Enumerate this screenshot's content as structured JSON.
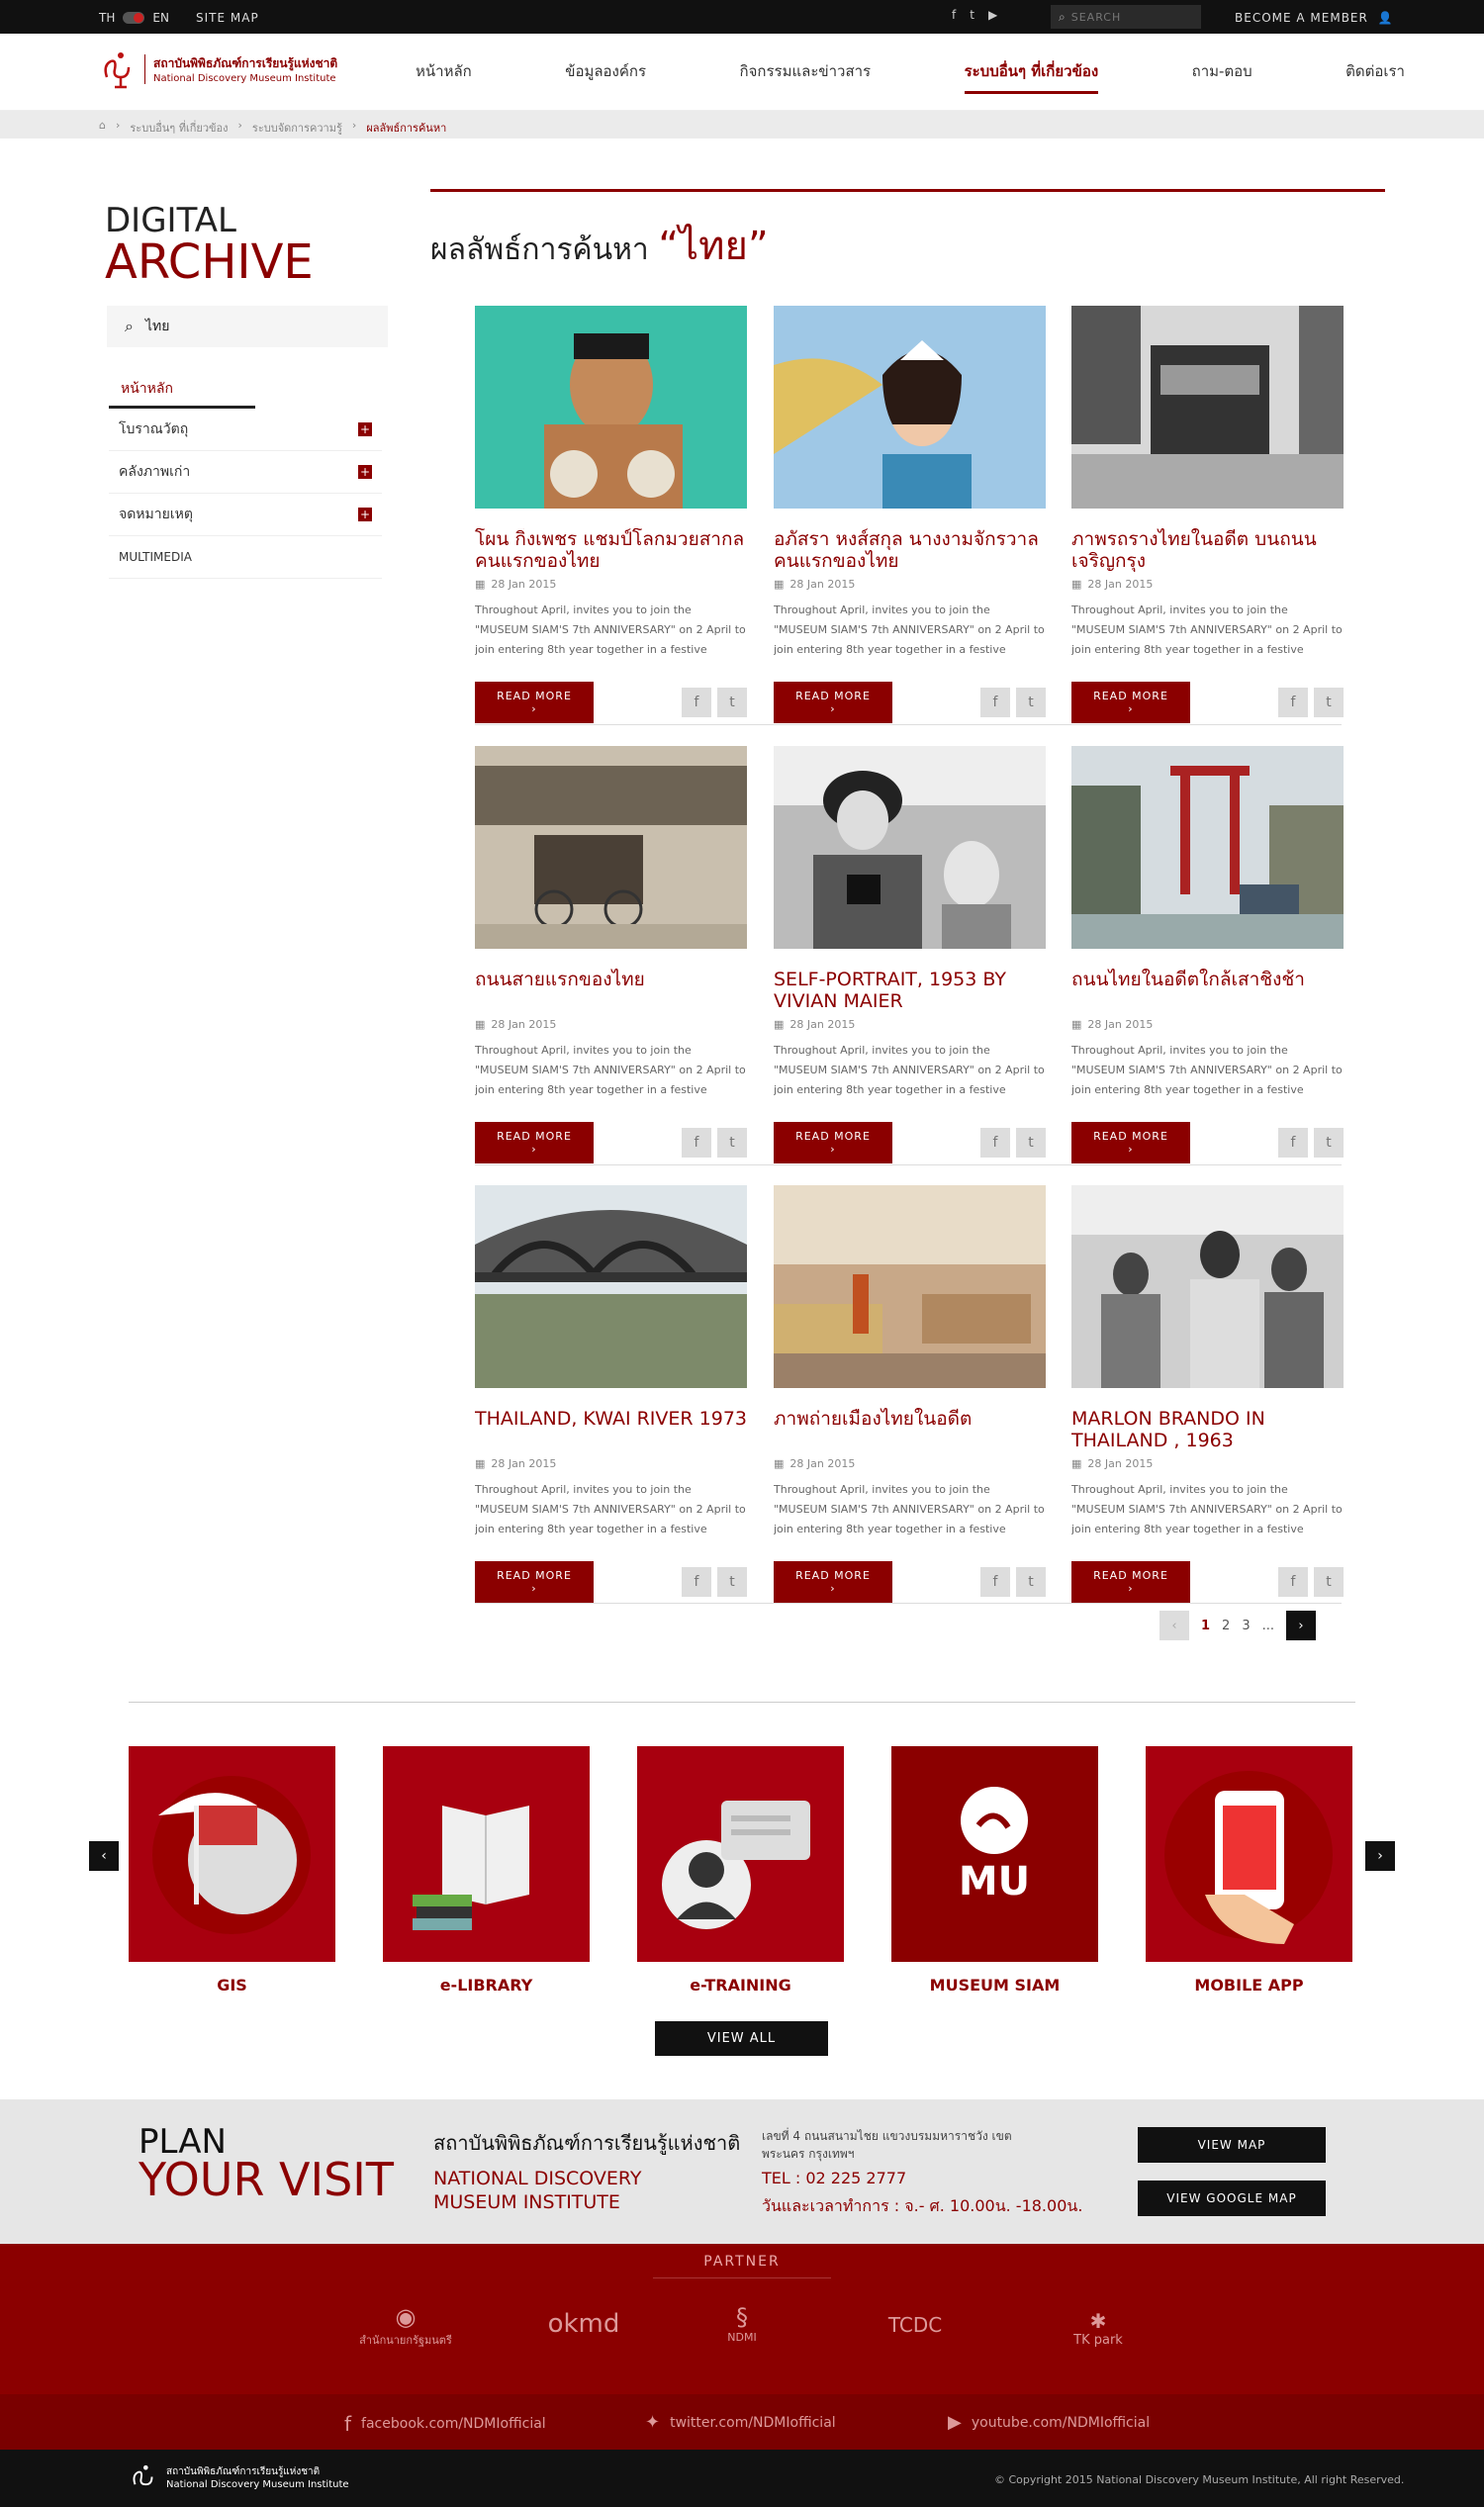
{
  "topbar": {
    "lang_th": "TH",
    "lang_en": "EN",
    "sitemap": "SITE MAP",
    "search_placeholder": "SEARCH",
    "member": "BECOME A MEMBER"
  },
  "logo": {
    "th": "สถาบันพิพิธภัณฑ์การเรียนรู้แห่งชาติ",
    "en": "National Discovery Museum Institute"
  },
  "nav": [
    "หน้าหลัก",
    "ข้อมูลองค์กร",
    "กิจกรรมและข่าวสาร",
    "ระบบอื่นๆ ที่เกี่ยวข้อง",
    "ถาม-ตอบ",
    "ติดต่อเรา"
  ],
  "breadcrumb": {
    "c1": "ระบบอื่นๆ ที่เกี่ยวข้อง",
    "c2": "ระบบจัดการความรู้",
    "c3": "ผลลัพธ์การค้นหา"
  },
  "sidebar": {
    "title1": "DIGITAL",
    "title2": "ARCHIVE",
    "search_value": "ไทย",
    "home": "หน้าหลัก",
    "items": [
      "โบราณวัตถุ",
      "คลังภาพเก่า",
      "จดหมายเหตุ",
      "MULTIMEDIA"
    ]
  },
  "results": {
    "label": "ผลลัพธ์การค้นหา",
    "query": "“ไทย”"
  },
  "cards": [
    {
      "title": "โผน กิ่งเพชร แชมป์โลกมวยสากลคนแรกของไทย",
      "date": "28 Jan 2015"
    },
    {
      "title": "อภัสรา หงส์สกุล นางงามจักรวาลคนแรกของไทย",
      "date": "28 Jan 2015"
    },
    {
      "title": "ภาพรถรางไทยในอดีต บนถนนเจริญกรุง",
      "date": "28 Jan 2015"
    },
    {
      "title": "ถนนสายแรกของไทย",
      "date": "28 Jan 2015"
    },
    {
      "title": "SELF-PORTRAIT, 1953 BY VIVIAN MAIER",
      "date": "28 Jan 2015"
    },
    {
      "title": "ถนนไทยในอดีตใกล้เสาชิงช้า",
      "date": "28 Jan 2015"
    },
    {
      "title": "THAILAND, KWAI RIVER 1973",
      "date": "28 Jan 2015"
    },
    {
      "title": "ภาพถ่ายเมืองไทยในอดีต",
      "date": "28 Jan 2015"
    },
    {
      "title": "MARLON BRANDO IN THAILAND , 1963",
      "date": "28 Jan 2015"
    }
  ],
  "card_desc": "Throughout April, invites you to join the \"MUSEUM SIAM'S 7th ANNIVERSARY\" on 2 April to join entering 8th year together in a festive atmosphere that ..",
  "read_more": "READ MORE",
  "pager": {
    "p1": "1",
    "p2": "2",
    "p3": "3",
    "dots": "..."
  },
  "services": [
    "GIS",
    "e-LIBRARY",
    "e-TRAINING",
    "MUSEUM SIAM",
    "MOBILE APP"
  ],
  "view_all": "VIEW ALL",
  "plan": {
    "l1": "PLAN",
    "l2": "YOUR VISIT",
    "inst_th": "สถาบันพิพิธภัณฑ์การเรียนรู้แห่งชาติ",
    "inst_en": "NATIONAL DISCOVERY MUSEUM INSTITUTE",
    "addr": "เลขที่ 4 ถนนสนามไชย แขวงบรมมหาราชวัง เขตพระนคร กรุงเทพฯ",
    "tel": "TEL : 02 225 2777",
    "hours": "วันและเวลาทำการ : จ.- ศ. 10.00น. -18.00น.",
    "btn_map": "VIEW MAP",
    "btn_gmap": "VIEW GOOGLE MAP"
  },
  "partner": {
    "heading": "PARTNER",
    "logos": [
      "สำนักนายกรัฐมนตรี",
      "okmd",
      "NDMI",
      "TCDC",
      "TK park"
    ]
  },
  "footer_links": {
    "fb": "facebook.com/NDMIofficial",
    "tw": "twitter.com/NDMIofficial",
    "yt": "youtube.com/NDMIofficial"
  },
  "footer": {
    "copy": "© Copyright 2015 National Discovery Museum Institute, All right Reserved."
  },
  "colors": {
    "brand": "#8b0000",
    "accent": "#a8000f"
  }
}
